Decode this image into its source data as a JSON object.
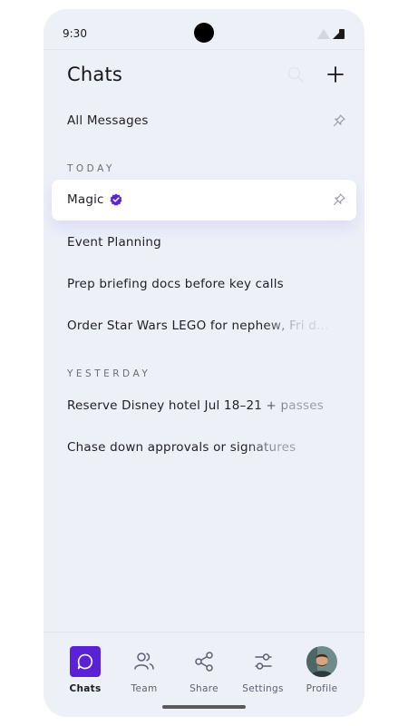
{
  "status_bar": {
    "time": "9:30"
  },
  "header": {
    "title": "Chats"
  },
  "pinned": {
    "label": "All Messages"
  },
  "sections": [
    {
      "heading": "TODAY",
      "items": [
        "Magic",
        "Event Planning",
        "Prep briefing docs before key calls",
        "Order Star Wars LEGO for nephew, Fri d..."
      ]
    },
    {
      "heading": "YESTERDAY",
      "items": [
        "Reserve Disney hotel Jul 18–21 + passes",
        "Chase down approvals or signatures"
      ]
    }
  ],
  "nav": [
    {
      "label": "Chats",
      "icon": "chat-bubble-icon",
      "active": true
    },
    {
      "label": "Team",
      "icon": "team-icon"
    },
    {
      "label": "Share",
      "icon": "share-icon"
    },
    {
      "label": "Settings",
      "icon": "settings-sliders-icon"
    },
    {
      "label": "Profile",
      "icon": "avatar"
    }
  ],
  "colors": {
    "accent": "#5b21d6",
    "background": "#eef0f8",
    "selected_card": "#ffffff"
  }
}
